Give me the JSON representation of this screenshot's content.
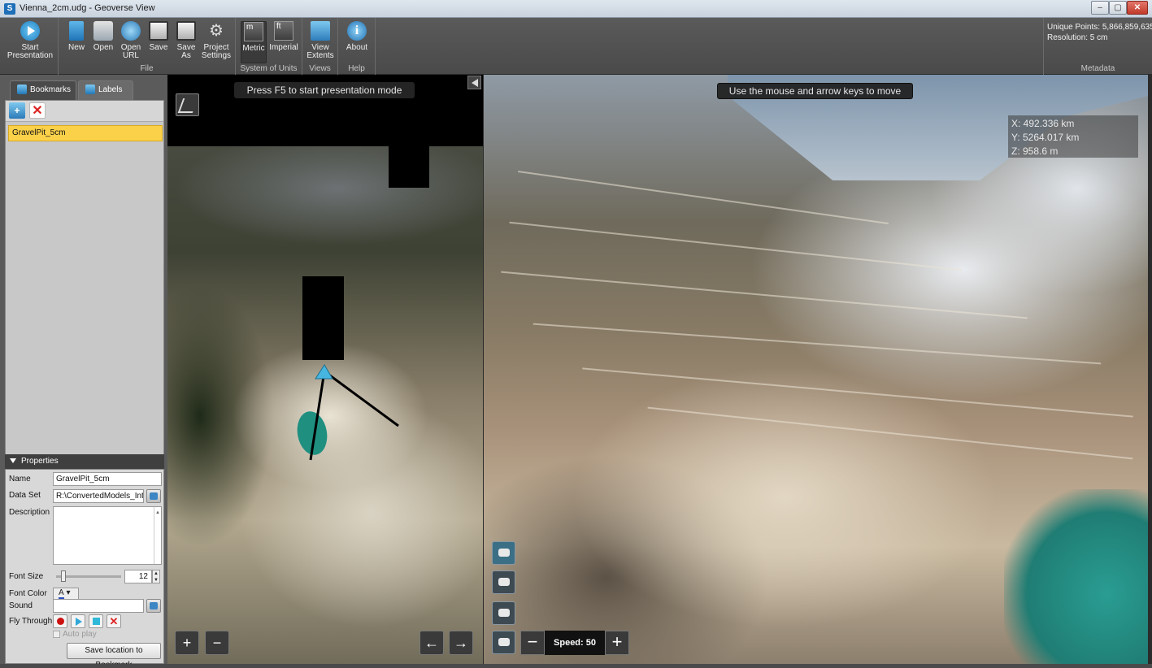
{
  "window": {
    "title": "Vienna_2cm.udg - Geoverse View",
    "app_icon": "app-logo",
    "controls": {
      "minimize": "‒",
      "maximize": "▢",
      "close": "✕"
    }
  },
  "ribbon": {
    "groups": {
      "presentation": {
        "start_label": "Start Presentation"
      },
      "file": {
        "label": "File",
        "new": "New",
        "open": "Open",
        "open_url": "Open URL",
        "save": "Save",
        "save_as": "Save As",
        "project_settings": "Project Settings"
      },
      "units": {
        "label": "System of Units",
        "metric": "Metric",
        "imperial": "Imperial",
        "metric_icon_text": "m",
        "imperial_icon_text": "ft"
      },
      "views": {
        "label": "Views",
        "view_extents": "View Extents"
      },
      "help": {
        "label": "Help",
        "about": "About"
      }
    },
    "metadata": {
      "label": "Metadata",
      "unique_points": "Unique Points: 5,866,859,635",
      "resolution": "Resolution: 5 cm"
    }
  },
  "left_panel": {
    "tabs": {
      "bookmarks": "Bookmarks",
      "labels": "Labels"
    },
    "bookmarks": [
      {
        "name": "GravelPit_5cm",
        "selected": true
      }
    ],
    "properties": {
      "header": "Properties",
      "name_label": "Name",
      "name_value": "GravelPit_5cm",
      "dataset_label": "Data Set",
      "dataset_value": "R:\\ConvertedModels_Inter",
      "description_label": "Description",
      "description_value": "",
      "font_size_label": "Font Size",
      "font_size_value": "12",
      "font_color_label": "Font Color",
      "font_color_glyph": "A",
      "sound_label": "Sound",
      "sound_value": "",
      "fly_through_label": "Fly Through",
      "auto_play_label": "Auto play",
      "save_button": "Save location to Bookmark"
    }
  },
  "map_view": {
    "hint": "Press F5 to start presentation mode",
    "zoom_in": "+",
    "zoom_out": "−",
    "pan_left": "←",
    "pan_right": "→"
  },
  "view_3d": {
    "hint": "Use the mouse and arrow keys to move",
    "coords": {
      "x": "X: 492.336 km",
      "y": "Y: 5264.017 km",
      "z": "Z: 958.6 m"
    },
    "speed_label": "Speed: 50",
    "speed_minus": "−",
    "speed_plus": "+"
  },
  "colors": {
    "ribbon_bg": "#505050",
    "bookmark_selected": "#fbd14a",
    "accent_blue": "#2b7ab8"
  }
}
